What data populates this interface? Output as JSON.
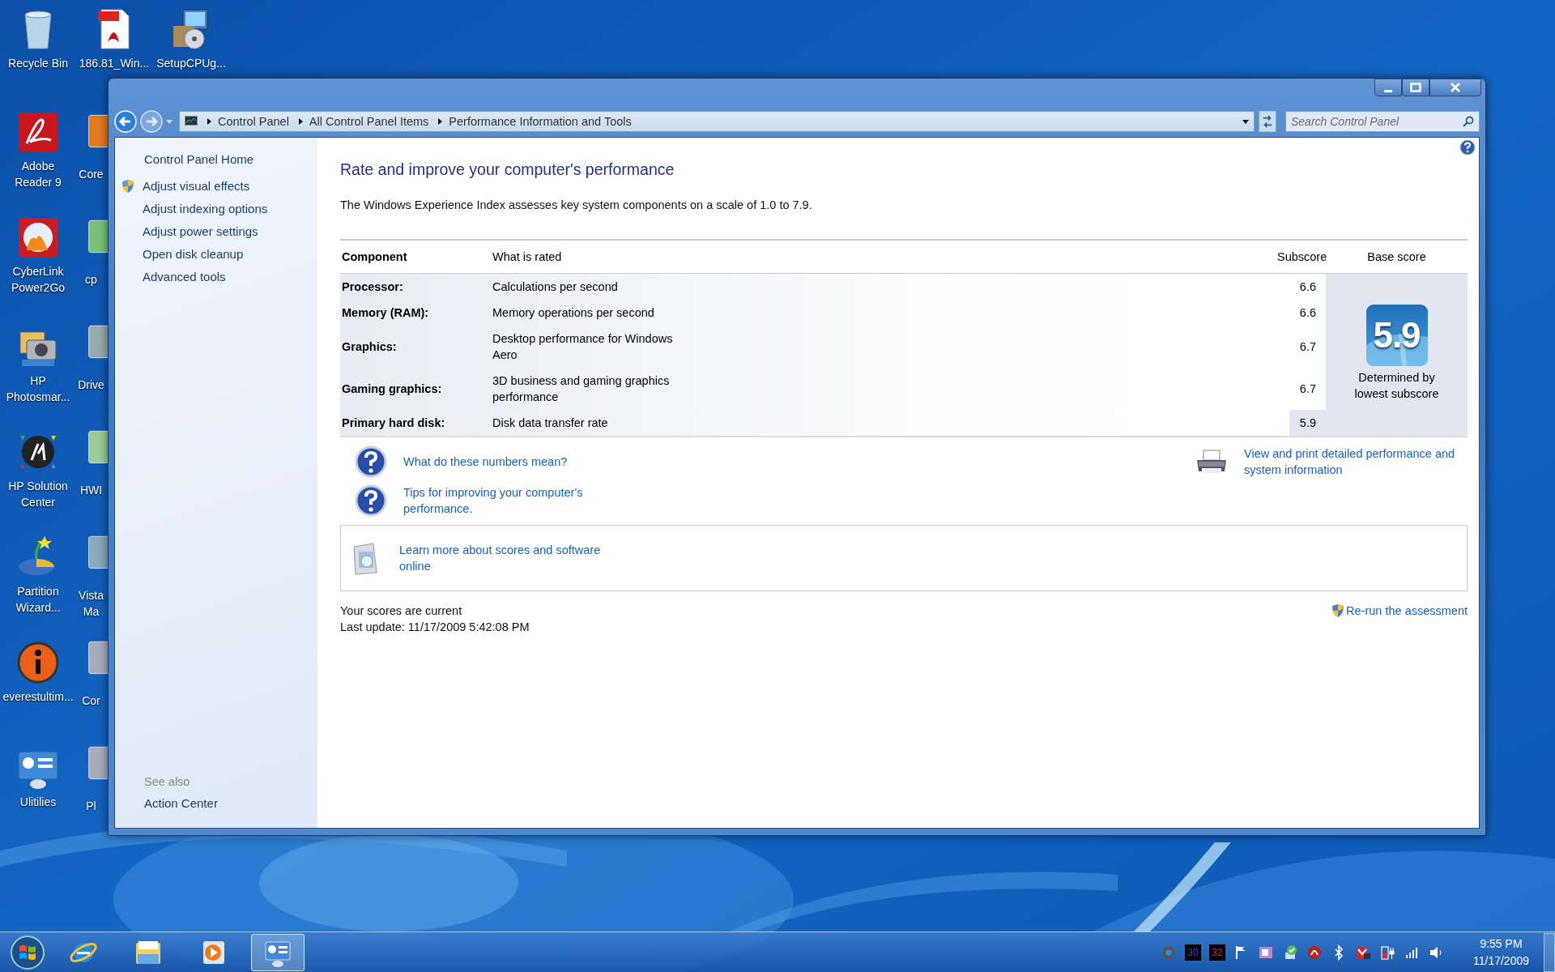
{
  "desktop_icons": [
    {
      "label": "Recycle Bin"
    },
    {
      "label": "186.81_Win..."
    },
    {
      "label": "SetupCPUg..."
    },
    {
      "label": "Adobe Reader 9"
    },
    {
      "label": "CyberLink Power2Go"
    },
    {
      "label": "HP Photosmar..."
    },
    {
      "label": "HP Solution Center"
    },
    {
      "label": "Partition Wizard..."
    },
    {
      "label": "everestultim..."
    },
    {
      "label": "Ulitilies"
    }
  ],
  "covered_icons": [
    {
      "label": "Core"
    },
    {
      "label": "cp"
    },
    {
      "label": "Drive"
    },
    {
      "label": "HWI"
    },
    {
      "label": "Vista Ma"
    },
    {
      "label": "Cor"
    },
    {
      "label": "Pl"
    }
  ],
  "window": {
    "breadcrumbs": [
      "Control Panel",
      "All Control Panel Items",
      "Performance Information and Tools"
    ],
    "search": {
      "placeholder": "Search Control Panel"
    },
    "sidebar": {
      "home": "Control Panel Home",
      "items": [
        {
          "label": "Adjust visual effects",
          "shield": true
        },
        {
          "label": "Adjust indexing options",
          "shield": false
        },
        {
          "label": "Adjust power settings",
          "shield": false
        },
        {
          "label": "Open disk cleanup",
          "shield": false
        },
        {
          "label": "Advanced tools",
          "shield": false
        }
      ],
      "see_also": "See also",
      "see_also_items": [
        "Action Center"
      ]
    },
    "heading": "Rate and improve your computer's performance",
    "description": "The Windows Experience Index assesses key system components on a scale of 1.0 to 7.9.",
    "table": {
      "columns": [
        "Component",
        "What is rated",
        "Subscore",
        "Base score"
      ],
      "rows": [
        {
          "component": "Processor:",
          "rated": "Calculations per second",
          "subscore": "6.6",
          "lowest": false
        },
        {
          "component": "Memory (RAM):",
          "rated": "Memory operations per second",
          "subscore": "6.6",
          "lowest": false
        },
        {
          "component": "Graphics:",
          "rated": "Desktop performance for Windows Aero",
          "subscore": "6.7",
          "lowest": false
        },
        {
          "component": "Gaming graphics:",
          "rated": "3D business and gaming graphics performance",
          "subscore": "6.7",
          "lowest": false
        },
        {
          "component": "Primary hard disk:",
          "rated": "Disk data transfer rate",
          "subscore": "5.9",
          "lowest": true
        }
      ],
      "base_score": "5.9",
      "base_caption": "Determined by lowest subscore"
    },
    "help_links": [
      "What do these numbers mean?",
      "Tips for improving your computer's performance."
    ],
    "print_link": "View and print detailed performance and system information",
    "learn_link": "Learn more about scores and software online",
    "status": [
      "Your scores are current",
      "Last update: 11/17/2009 5:42:08 PM"
    ],
    "rerun_link": "Re-run the assessment"
  },
  "taskbar": {
    "items": [
      {
        "selected": false
      },
      {
        "selected": false
      },
      {
        "selected": false
      },
      {
        "selected": true
      }
    ],
    "tray_readings": [
      "30",
      "32"
    ],
    "time": "9:55 PM",
    "date": "11/17/2009"
  }
}
